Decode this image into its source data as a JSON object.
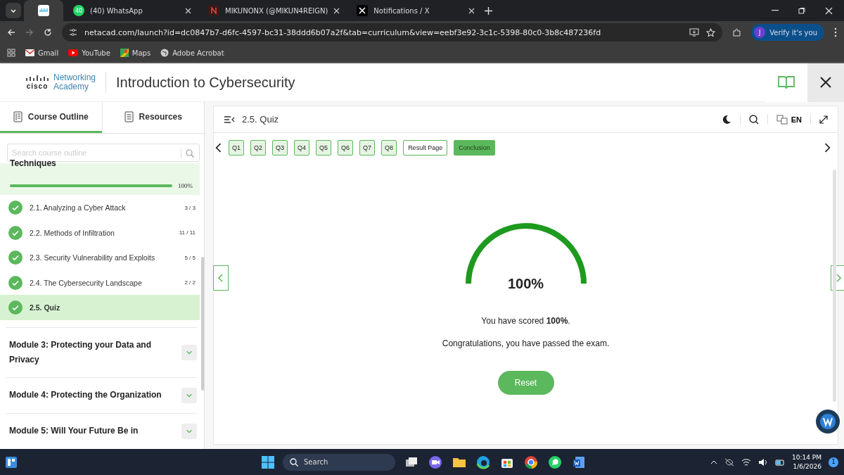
{
  "browser": {
    "tabs": [
      {
        "selected": true
      },
      {
        "title": "(40) WhatsApp",
        "badge": "40",
        "selected": false
      },
      {
        "title": "MIKUNONX (@MIKUN4REIGN)",
        "selected": false
      },
      {
        "title": "Notifications / X",
        "selected": false
      }
    ],
    "address": "netacad.com/launch?id=dc0847b7-d6fc-4597-bc31-38ddd6b07a2f&tab=curriculum&view=eebf3e92-3c1c-5398-80c0-3b8c487236fd",
    "profile": {
      "initial": "J",
      "label": "Verify it's you"
    },
    "bookmarks": [
      "Gmail",
      "YouTube",
      "Maps",
      "Adobe Acrobat"
    ]
  },
  "header": {
    "logo_word": "cisco",
    "logo_line1": "Networking",
    "logo_line2": "Academy",
    "title": "Introduction to Cybersecurity"
  },
  "sidebar": {
    "tabs": [
      {
        "label": "Course Outline",
        "selected": true
      },
      {
        "label": "Resources",
        "selected": false
      }
    ],
    "search": {
      "placeholder": "Search course outline"
    },
    "current_module": {
      "title": "Techniques",
      "level": 1,
      "percent": "100%"
    },
    "items": [
      {
        "label": "2.1. Analyzing a Cyber Attack",
        "count": "3 / 3",
        "done": true,
        "selected": false
      },
      {
        "label": "2.2. Methods of Infiltration",
        "count": "11 / 11",
        "done": true,
        "selected": false
      },
      {
        "label": "2.3. Security Vulnerability and Exploits",
        "count": "5 / 5",
        "done": true,
        "selected": false
      },
      {
        "label": "2.4. The Cybersecurity Landscape",
        "count": "2 / 2",
        "done": true,
        "selected": false
      },
      {
        "label": "2.5. Quiz",
        "done": true,
        "selected": true
      }
    ],
    "modules": [
      {
        "title": "Module 3: Protecting your Data and Privacy"
      },
      {
        "title": "Module 4: Protecting the Organization"
      },
      {
        "title": "Module 5: Will Your Future Be in"
      }
    ]
  },
  "content": {
    "breadcrumb": "2.5. Quiz",
    "language": "EN",
    "pages": [
      {
        "label": "Q1",
        "kind": "question",
        "selected": false
      },
      {
        "label": "Q2",
        "kind": "question",
        "selected": false
      },
      {
        "label": "Q3",
        "kind": "question",
        "selected": false
      },
      {
        "label": "Q4",
        "kind": "question",
        "selected": false
      },
      {
        "label": "Q5",
        "kind": "question",
        "selected": false
      },
      {
        "label": "Q6",
        "kind": "question",
        "selected": false
      },
      {
        "label": "Q7",
        "kind": "question",
        "selected": false
      },
      {
        "label": "Q8",
        "kind": "question",
        "selected": false
      },
      {
        "label": "Result Page",
        "kind": "page",
        "selected": false
      },
      {
        "label": "Conclusion",
        "kind": "page",
        "selected": true
      }
    ],
    "score": {
      "level": 1,
      "reading": "100%"
    },
    "message": "You have scored **100%**.",
    "note": "Congratulations, you have passed the exam.",
    "button": "Reset"
  },
  "taskbar": {
    "search": "Search",
    "time": "10:14 PM",
    "date": "1/6/2026",
    "notifications": "1"
  }
}
